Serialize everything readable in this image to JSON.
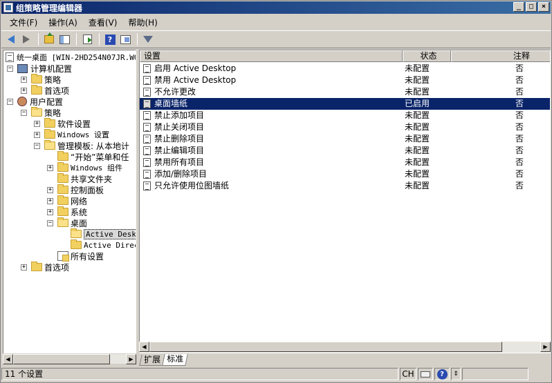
{
  "window": {
    "title": "组策略管理编辑器",
    "btn_min": "_",
    "btn_max": "□",
    "btn_close": "×"
  },
  "menubar": {
    "items": [
      "文件(F)",
      "操作(A)",
      "查看(V)",
      "帮助(H)"
    ]
  },
  "toolbar": {
    "icons": [
      "back-arrow-icon",
      "forward-arrow-icon",
      "up-folder-icon",
      "show-hide-tree-icon",
      "export-list-icon",
      "help-icon",
      "properties-icon",
      "filter-icon"
    ]
  },
  "tree": {
    "root": "统一桌面 [WIN-2HD254N07JR.WO",
    "computer_config": "计算机配置",
    "policies_1": "策略",
    "preferences_1": "首选项",
    "user_config": "用户配置",
    "policies_2": "策略",
    "software_settings": "软件设置",
    "windows_settings": "Windows 设置",
    "admin_templates": "管理模板: 从本地计",
    "start_menu": "“开始”菜单和任",
    "windows_components": "Windows 组件",
    "shared_folders": "共享文件夹",
    "control_panel": "控制面板",
    "network": "网络",
    "system": "系统",
    "desktop": "桌面",
    "active_desktop": "Active Deskt",
    "active_directory": "Active Direc",
    "all_settings": "所有设置",
    "preferences_2": "首选项"
  },
  "list": {
    "headers": {
      "setting": "设置",
      "state": "状态",
      "comment": "注释"
    },
    "rows": [
      {
        "setting": "启用 Active Desktop",
        "state": "未配置",
        "comment": "否"
      },
      {
        "setting": "禁用 Active Desktop",
        "state": "未配置",
        "comment": "否"
      },
      {
        "setting": "不允许更改",
        "state": "未配置",
        "comment": "否"
      },
      {
        "setting": "桌面墙纸",
        "state": "已启用",
        "comment": "否"
      },
      {
        "setting": "禁止添加项目",
        "state": "未配置",
        "comment": "否"
      },
      {
        "setting": "禁止关闭项目",
        "state": "未配置",
        "comment": "否"
      },
      {
        "setting": "禁止删除项目",
        "state": "未配置",
        "comment": "否"
      },
      {
        "setting": "禁止编辑项目",
        "state": "未配置",
        "comment": "否"
      },
      {
        "setting": "禁用所有项目",
        "state": "未配置",
        "comment": "否"
      },
      {
        "setting": "添加/删除项目",
        "state": "未配置",
        "comment": "否"
      },
      {
        "setting": "只允许使用位图墙纸",
        "state": "未配置",
        "comment": "否"
      }
    ],
    "selected_index": 3
  },
  "tabs": [
    "扩展",
    "标准"
  ],
  "status": {
    "count_text": "11 个设置",
    "lang": "CH"
  },
  "colors": {
    "selection": "#0a246a",
    "titlebar": "#0a246a",
    "chrome": "#d4d0c8"
  }
}
